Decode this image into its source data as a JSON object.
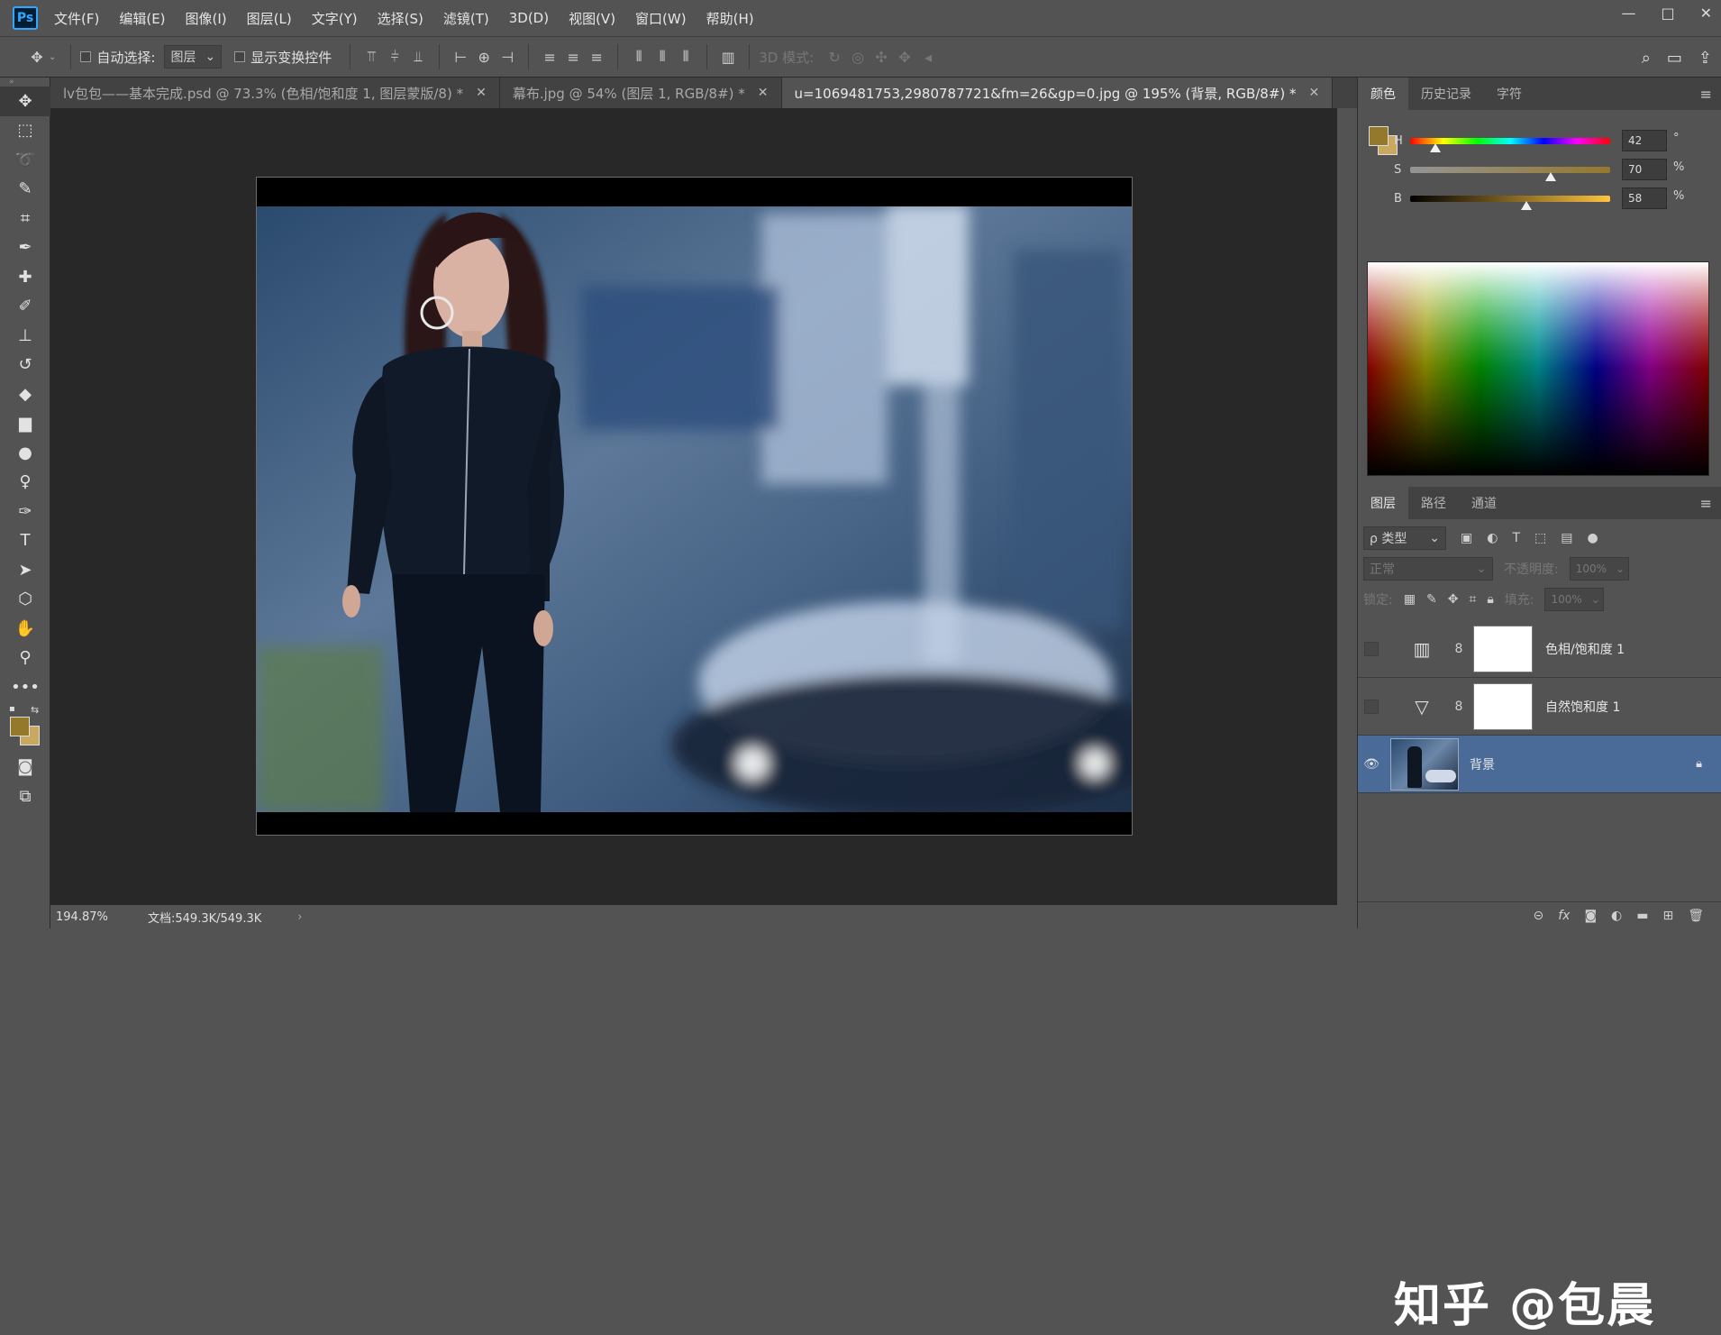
{
  "app": {
    "logo": "Ps"
  },
  "menu": [
    "文件(F)",
    "编辑(E)",
    "图像(I)",
    "图层(L)",
    "文字(Y)",
    "选择(S)",
    "滤镜(T)",
    "3D(D)",
    "视图(V)",
    "窗口(W)",
    "帮助(H)"
  ],
  "window_controls": {
    "minimize": "—",
    "maximize": "□",
    "close": "✕"
  },
  "options": {
    "auto_select_label": "自动选择:",
    "auto_select_value": "图层",
    "show_transform_label": "显示变换控件",
    "mode_3d_label": "3D 模式:"
  },
  "tabs": [
    {
      "label": "lv包包——基本完成.psd @ 73.3% (色相/饱和度 1, 图层蒙版/8) *",
      "close": "✕"
    },
    {
      "label": "幕布.jpg @ 54% (图层 1, RGB/8#) *",
      "close": "✕"
    },
    {
      "label": "u=1069481753,2980787721&fm=26&gp=0.jpg  @  195% (背景, RGB/8#) *",
      "close": "✕"
    }
  ],
  "status": {
    "zoom": "194.87%",
    "doc": "文档:549.3K/549.3K",
    "arrow": "›"
  },
  "color_panel": {
    "tabs": [
      "颜色",
      "历史记录",
      "字符"
    ],
    "h_label": "H",
    "h_value": "42",
    "h_unit": "°",
    "s_label": "S",
    "s_value": "70",
    "s_unit": "%",
    "b_label": "B",
    "b_value": "58",
    "b_unit": "%",
    "fg_color": "#94782c",
    "bg_color": "#c9a860"
  },
  "layers_panel": {
    "tabs": [
      "图层",
      "路径",
      "通道"
    ],
    "filter_label": "ρ 类型",
    "blend_mode": "正常",
    "opacity_label": "不透明度:",
    "opacity_value": "100%",
    "lock_label": "锁定:",
    "fill_label": "填充:",
    "fill_value": "100%",
    "layers": [
      {
        "name": "色相/饱和度 1",
        "icon": "hue-saturation-icon"
      },
      {
        "name": "自然饱和度 1",
        "icon": "vibrance-icon"
      },
      {
        "name": "背景",
        "icon": "lock-icon"
      }
    ]
  },
  "watermark": "知乎 @包晨"
}
